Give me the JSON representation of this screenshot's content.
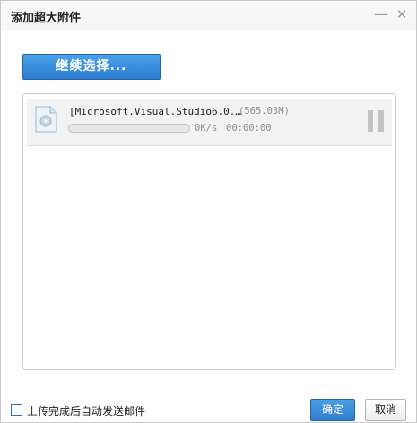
{
  "dialog": {
    "title": "添加超大附件",
    "minimize_icon": "minimize-icon",
    "close_icon": "close-icon"
  },
  "toolbar": {
    "continue_label": "继续选择..."
  },
  "files": [
    {
      "name": "[Microsoft.Visual.Studio6.0.…",
      "size": "(565.03M)",
      "progress": 0,
      "speed": "0K/s",
      "elapsed": "00:00:00",
      "icon": "file-icon",
      "action_icon": "pause-icon"
    }
  ],
  "footer": {
    "auto_send_label": "上传完成后自动发送邮件",
    "auto_send_checked": false,
    "ok_label": "确定",
    "cancel_label": "取消"
  },
  "colors": {
    "accent": "#2d7ed2",
    "progress_fill": "#5fa2e4"
  }
}
